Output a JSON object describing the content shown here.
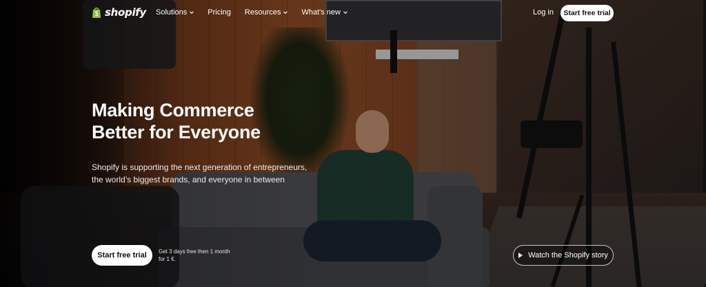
{
  "nav": {
    "logo_text": "shopify",
    "links": [
      {
        "label": "Solutions",
        "has_dropdown": true
      },
      {
        "label": "Pricing",
        "has_dropdown": false
      },
      {
        "label": "Resources",
        "has_dropdown": true
      },
      {
        "label": "What's new",
        "has_dropdown": true
      }
    ],
    "login_label": "Log in",
    "cta_label": "Start free trial"
  },
  "hero": {
    "title_line1": "Making Commerce",
    "title_line2": "Better for Everyone",
    "subtitle_line1": "Shopify is supporting the next generation of entrepreneurs,",
    "subtitle_line2": "the world’s biggest brands, and everyone in between",
    "primary_cta": "Start free trial",
    "trial_note_line1": "Get 3 days free then 1 month",
    "trial_note_line2": "for 1 €.",
    "story_cta": "Watch the Shopify story"
  },
  "colors": {
    "button_bg": "#ffffff",
    "button_text": "#111111",
    "text": "#ffffff",
    "logo_green": "#95bf47"
  },
  "icons": [
    "shopify-bag-icon",
    "chevron-down-icon",
    "play-icon"
  ]
}
